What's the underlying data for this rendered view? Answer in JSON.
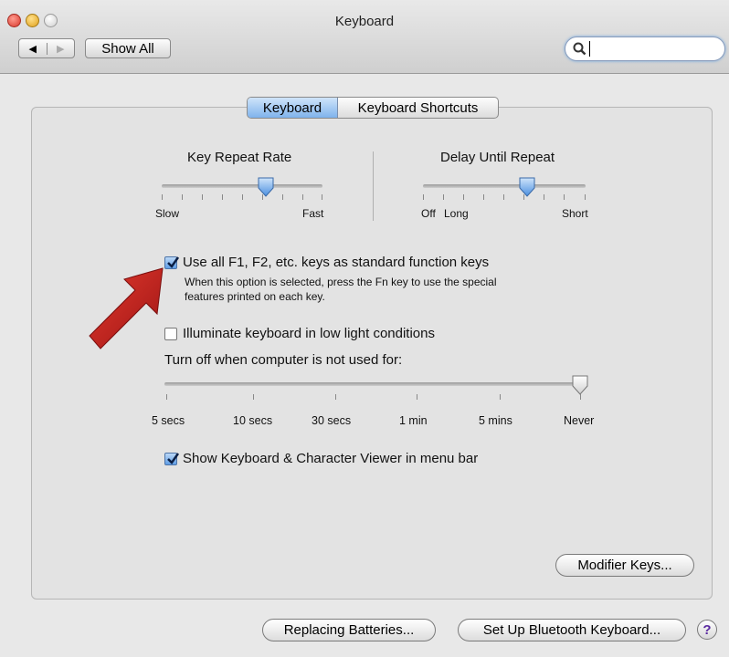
{
  "window": {
    "title": "Keyboard"
  },
  "toolbar": {
    "show_all_label": "Show All",
    "search_value": ""
  },
  "tabs": [
    {
      "label": "Keyboard",
      "selected": true
    },
    {
      "label": "Keyboard Shortcuts",
      "selected": false
    }
  ],
  "key_repeat": {
    "title": "Key Repeat Rate",
    "min_label": "Slow",
    "max_label": "Fast",
    "level": 0.65
  },
  "delay_repeat": {
    "title": "Delay Until Repeat",
    "min_label": "Off",
    "mid_label": "Long",
    "max_label": "Short",
    "level": 0.65
  },
  "fn_keys": {
    "label": "Use all F1, F2, etc. keys as standard function keys",
    "description_line1": "When this option is selected, press the Fn key to use the special",
    "description_line2": "features printed on each key.",
    "checked": true
  },
  "illuminate": {
    "label": "Illuminate keyboard in low light conditions",
    "checked": false
  },
  "turn_off": {
    "label": "Turn off when computer is not used for:",
    "ticks": [
      "5 secs",
      "10 secs",
      "30 secs",
      "1 min",
      "5 mins",
      "Never"
    ],
    "selected": "Never"
  },
  "viewer": {
    "label": "Show Keyboard & Character Viewer in menu bar",
    "checked": true
  },
  "buttons": {
    "modifier_keys": "Modifier Keys...",
    "replacing_batteries": "Replacing Batteries...",
    "setup_bluetooth": "Set Up Bluetooth Keyboard...",
    "help": "?"
  },
  "colors": {
    "accent": "#5f9ee6",
    "arrow": "#c41d1d"
  }
}
